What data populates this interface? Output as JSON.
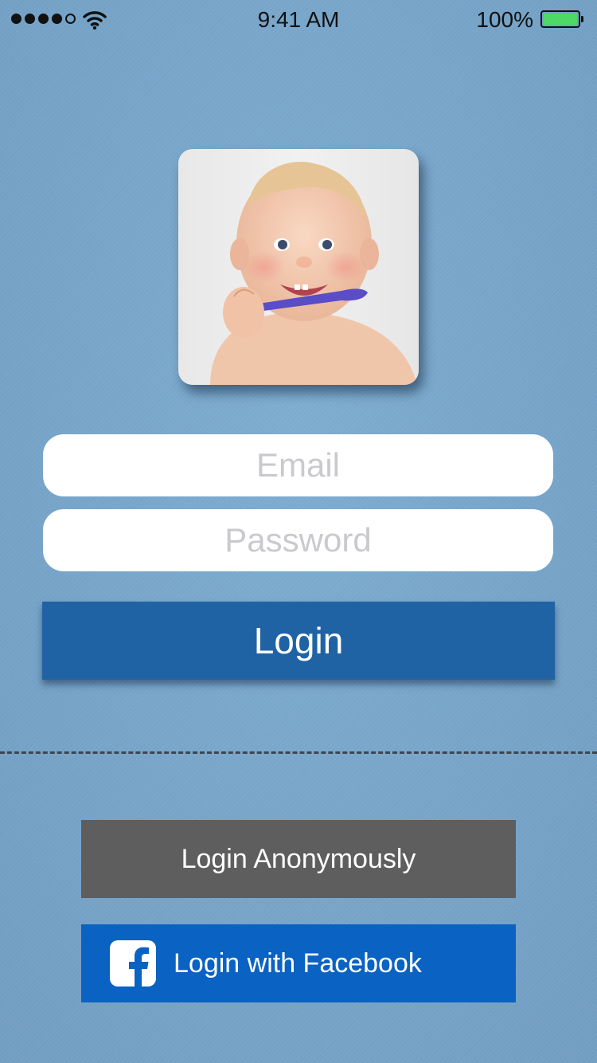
{
  "status_bar": {
    "time": "9:41 AM",
    "battery_percent": "100%",
    "signal_bars_filled": 4,
    "signal_bars_total": 5,
    "icons": [
      "signal-dots-icon",
      "wifi-icon",
      "battery-icon"
    ]
  },
  "profile": {
    "avatar": "baby-photo"
  },
  "form": {
    "email_placeholder": "Email",
    "email_value": "",
    "password_placeholder": "Password",
    "password_value": "",
    "login_label": "Login"
  },
  "alt_login": {
    "anonymous_label": "Login Anonymously",
    "facebook_label": "Login with Facebook",
    "facebook_icon": "facebook-icon"
  },
  "colors": {
    "background": "#77a6cb",
    "login_button": "#1f63a5",
    "anonymous_button": "#5e5e5e",
    "facebook_button": "#0a62c2",
    "battery_fill": "#4cd964"
  }
}
